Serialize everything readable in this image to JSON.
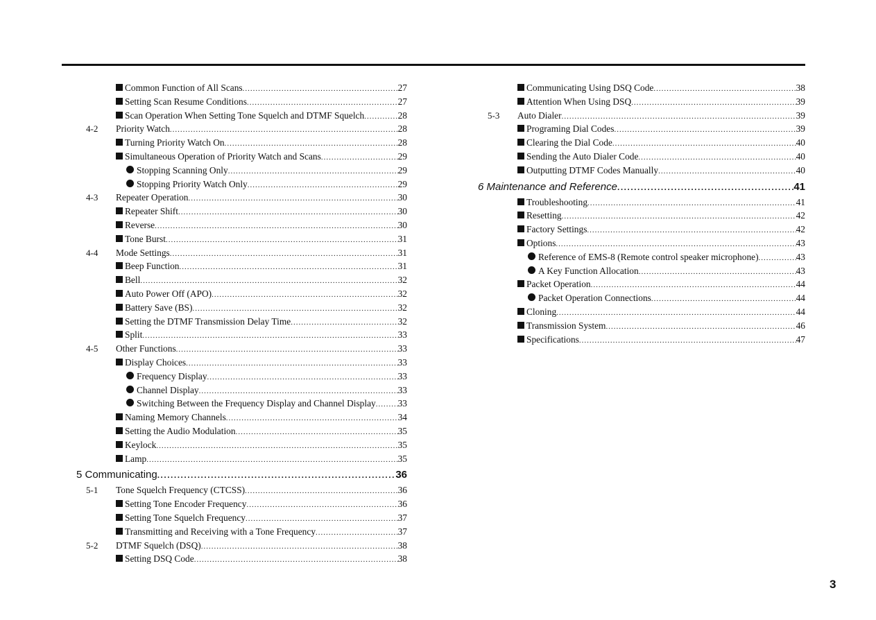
{
  "document": {
    "page_number": "3",
    "left_column": [
      {
        "level": "sub",
        "bullet": "square",
        "label": "Common Function of All Scans",
        "page": "27"
      },
      {
        "level": "sub",
        "bullet": "square",
        "label": "Setting Scan Resume Conditions",
        "page": "27"
      },
      {
        "level": "sub",
        "bullet": "square",
        "label": "Scan Operation When Setting Tone Squelch and DTMF Squelch",
        "page": "28"
      },
      {
        "level": "sec",
        "num": "4-2",
        "label": "Priority Watch",
        "page": "28"
      },
      {
        "level": "sub",
        "bullet": "square",
        "label": "Turning Priority Watch On",
        "page": "28"
      },
      {
        "level": "sub",
        "bullet": "square",
        "label": "Simultaneous Operation of Priority Watch and Scans",
        "page": "29"
      },
      {
        "level": "subsub",
        "bullet": "dot",
        "label": "Stopping Scanning Only",
        "page": "29"
      },
      {
        "level": "subsub",
        "bullet": "dot",
        "label": "Stopping Priority Watch Only",
        "page": "29"
      },
      {
        "level": "sec",
        "num": "4-3",
        "label": "Repeater Operation",
        "page": "30"
      },
      {
        "level": "sub",
        "bullet": "square",
        "label": "Repeater Shift",
        "page": "30"
      },
      {
        "level": "sub",
        "bullet": "square",
        "label": "Reverse",
        "page": "30"
      },
      {
        "level": "sub",
        "bullet": "square",
        "label": "Tone Burst",
        "page": "31"
      },
      {
        "level": "sec",
        "num": "4-4",
        "label": "Mode Settings",
        "page": "31"
      },
      {
        "level": "sub",
        "bullet": "square",
        "label": "Beep Function",
        "page": "31"
      },
      {
        "level": "sub",
        "bullet": "square",
        "label": "Bell",
        "page": "32"
      },
      {
        "level": "sub",
        "bullet": "square",
        "label": "Auto Power Off (APO)",
        "page": "32"
      },
      {
        "level": "sub",
        "bullet": "square",
        "label": "Battery Save (BS)",
        "page": "32"
      },
      {
        "level": "sub",
        "bullet": "square",
        "label": "Setting the DTMF Transmission Delay Time",
        "page": "32"
      },
      {
        "level": "sub",
        "bullet": "square",
        "label": "Split",
        "page": "33"
      },
      {
        "level": "sec",
        "num": "4-5",
        "label": "Other Functions",
        "page": "33"
      },
      {
        "level": "sub",
        "bullet": "square",
        "label": "Display Choices",
        "page": "33"
      },
      {
        "level": "subsub",
        "bullet": "dot",
        "label": "Frequency Display",
        "page": "33"
      },
      {
        "level": "subsub",
        "bullet": "dot",
        "label": "Channel Display",
        "page": "33"
      },
      {
        "level": "subsub",
        "bullet": "dot",
        "label": "Switching Between the Frequency Display and Channel Display",
        "page": "33"
      },
      {
        "level": "sub",
        "bullet": "square",
        "label": "Naming Memory Channels",
        "page": "34"
      },
      {
        "level": "sub",
        "bullet": "square",
        "label": "Setting the Audio Modulation",
        "page": "35"
      },
      {
        "level": "sub",
        "bullet": "square",
        "label": "Keylock",
        "page": "35"
      },
      {
        "level": "sub",
        "bullet": "square",
        "label": "Lamp",
        "page": "35"
      },
      {
        "level": "chapter",
        "label": "5 Communicating",
        "page": "36"
      },
      {
        "level": "sec",
        "num": "5-1",
        "label": "Tone Squelch Frequency (CTCSS)",
        "page": "36"
      },
      {
        "level": "sub",
        "bullet": "square",
        "label": "Setting Tone Encoder Frequency",
        "page": "36"
      },
      {
        "level": "sub",
        "bullet": "square",
        "label": "Setting Tone Squelch Frequency",
        "page": "37"
      },
      {
        "level": "sub",
        "bullet": "square",
        "label": "Transmitting and Receiving with a Tone Frequency",
        "page": "37"
      },
      {
        "level": "sec",
        "num": "5-2",
        "label": "DTMF Squelch (DSQ)",
        "page": "38"
      },
      {
        "level": "sub",
        "bullet": "square",
        "label": "Setting DSQ Code",
        "page": "38"
      }
    ],
    "right_column": [
      {
        "level": "sub",
        "bullet": "square",
        "label": "Communicating Using DSQ Code",
        "page": "38"
      },
      {
        "level": "sub",
        "bullet": "square",
        "label": "Attention When Using DSQ",
        "page": "39"
      },
      {
        "level": "sec",
        "num": "5-3",
        "label": "Auto Dialer",
        "page": "39"
      },
      {
        "level": "sub",
        "bullet": "square",
        "label": "Programing Dial Codes",
        "page": "39"
      },
      {
        "level": "sub",
        "bullet": "square",
        "label": "Clearing the Dial Code",
        "page": "40"
      },
      {
        "level": "sub",
        "bullet": "square",
        "label": "Sending the Auto Dialer Code",
        "page": "40"
      },
      {
        "level": "sub",
        "bullet": "square",
        "label": "Outputting DTMF Codes Manually",
        "page": "40"
      },
      {
        "level": "chapter",
        "label": "6 Maintenance and Reference",
        "page": "41",
        "italic": true
      },
      {
        "level": "sub",
        "bullet": "square",
        "label": "Troubleshooting",
        "page": "41"
      },
      {
        "level": "sub",
        "bullet": "square",
        "label": "Resetting",
        "page": "42"
      },
      {
        "level": "sub",
        "bullet": "square",
        "label": "Factory Settings",
        "page": "42"
      },
      {
        "level": "sub",
        "bullet": "square",
        "label": "Options",
        "page": "43"
      },
      {
        "level": "subsub",
        "bullet": "dot",
        "label": "Reference of EMS-8 (Remote control speaker microphone)",
        "page": "43"
      },
      {
        "level": "subsub",
        "bullet": "dot",
        "label": "A Key Function Allocation",
        "page": "43"
      },
      {
        "level": "sub",
        "bullet": "square",
        "label": "Packet Operation",
        "page": "44"
      },
      {
        "level": "subsub",
        "bullet": "dot",
        "label": "Packet Operation Connections",
        "page": "44"
      },
      {
        "level": "sub",
        "bullet": "square",
        "label": "Cloning",
        "page": "44"
      },
      {
        "level": "sub",
        "bullet": "square",
        "label": "Transmission System",
        "page": "46"
      },
      {
        "level": "sub",
        "bullet": "square",
        "label": "Specifications",
        "page": "47"
      }
    ]
  }
}
